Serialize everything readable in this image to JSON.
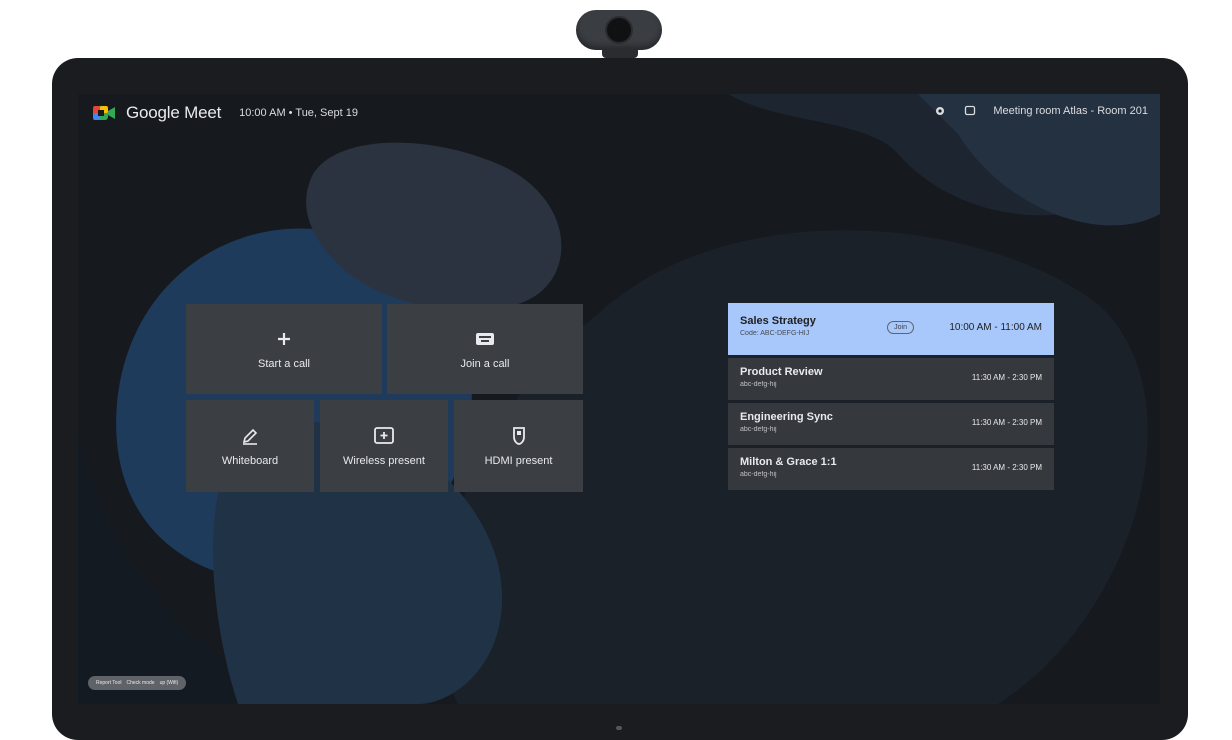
{
  "app": {
    "brand": "Google Meet",
    "clock": "10:00 AM • Tue, Sept 19"
  },
  "room": {
    "name": "Meeting room Atlas - Room 201"
  },
  "actions": [
    {
      "label": "Start a call",
      "icon": "plus-icon"
    },
    {
      "label": "Join a call",
      "icon": "keyboard-icon"
    },
    {
      "label": "Whiteboard",
      "icon": "pen-icon"
    },
    {
      "label": "Wireless present",
      "icon": "present-icon"
    },
    {
      "label": "HDMI present",
      "icon": "hdmi-icon"
    }
  ],
  "meetings": [
    {
      "title": "Sales Strategy",
      "code": "Code: ABC-DEFG-HIJ",
      "time": "10:00 AM - 11:00 AM",
      "badge": "Join",
      "active": true
    },
    {
      "title": "Product Review",
      "code": "abc-defg-hij",
      "time": "11:30 AM - 2:30 PM",
      "active": false
    },
    {
      "title": "Engineering Sync",
      "code": "abc-defg-hij",
      "time": "11:30 AM - 2:30 PM",
      "active": false
    },
    {
      "title": "Milton & Grace 1:1",
      "code": "abc-defg-hij",
      "time": "11:30 AM - 2:30 PM",
      "active": false
    }
  ],
  "status": {
    "items": [
      "Report Tool",
      "Check mode",
      "up (Wifi)"
    ]
  },
  "colors": {
    "accent": "#a8c7fa",
    "tile": "#3b3e43",
    "screen": "#16191e"
  }
}
